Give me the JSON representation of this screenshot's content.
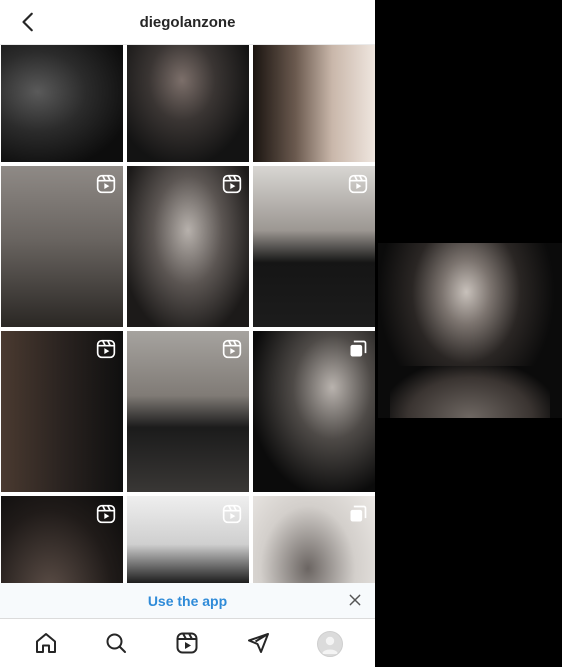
{
  "header": {
    "title": "diegolanzone"
  },
  "grid": {
    "tiles": [
      {
        "badge": "none"
      },
      {
        "badge": "none"
      },
      {
        "badge": "none"
      },
      {
        "badge": "reel-icon"
      },
      {
        "badge": "reel-icon"
      },
      {
        "badge": "reel-icon"
      },
      {
        "badge": "reel-icon"
      },
      {
        "badge": "reel-icon"
      },
      {
        "badge": "carousel-icon"
      },
      {
        "badge": "reel-icon"
      },
      {
        "badge": "reel-icon"
      },
      {
        "badge": "carousel-icon"
      }
    ]
  },
  "banner": {
    "cta": "Use the app"
  },
  "nav": {
    "items": [
      "home-icon",
      "search-icon",
      "reels-icon",
      "direct-icon",
      "profile-avatar"
    ]
  },
  "colors": {
    "link_blue": "#2f8bd8",
    "background": "#000000",
    "panel": "#ffffff"
  }
}
